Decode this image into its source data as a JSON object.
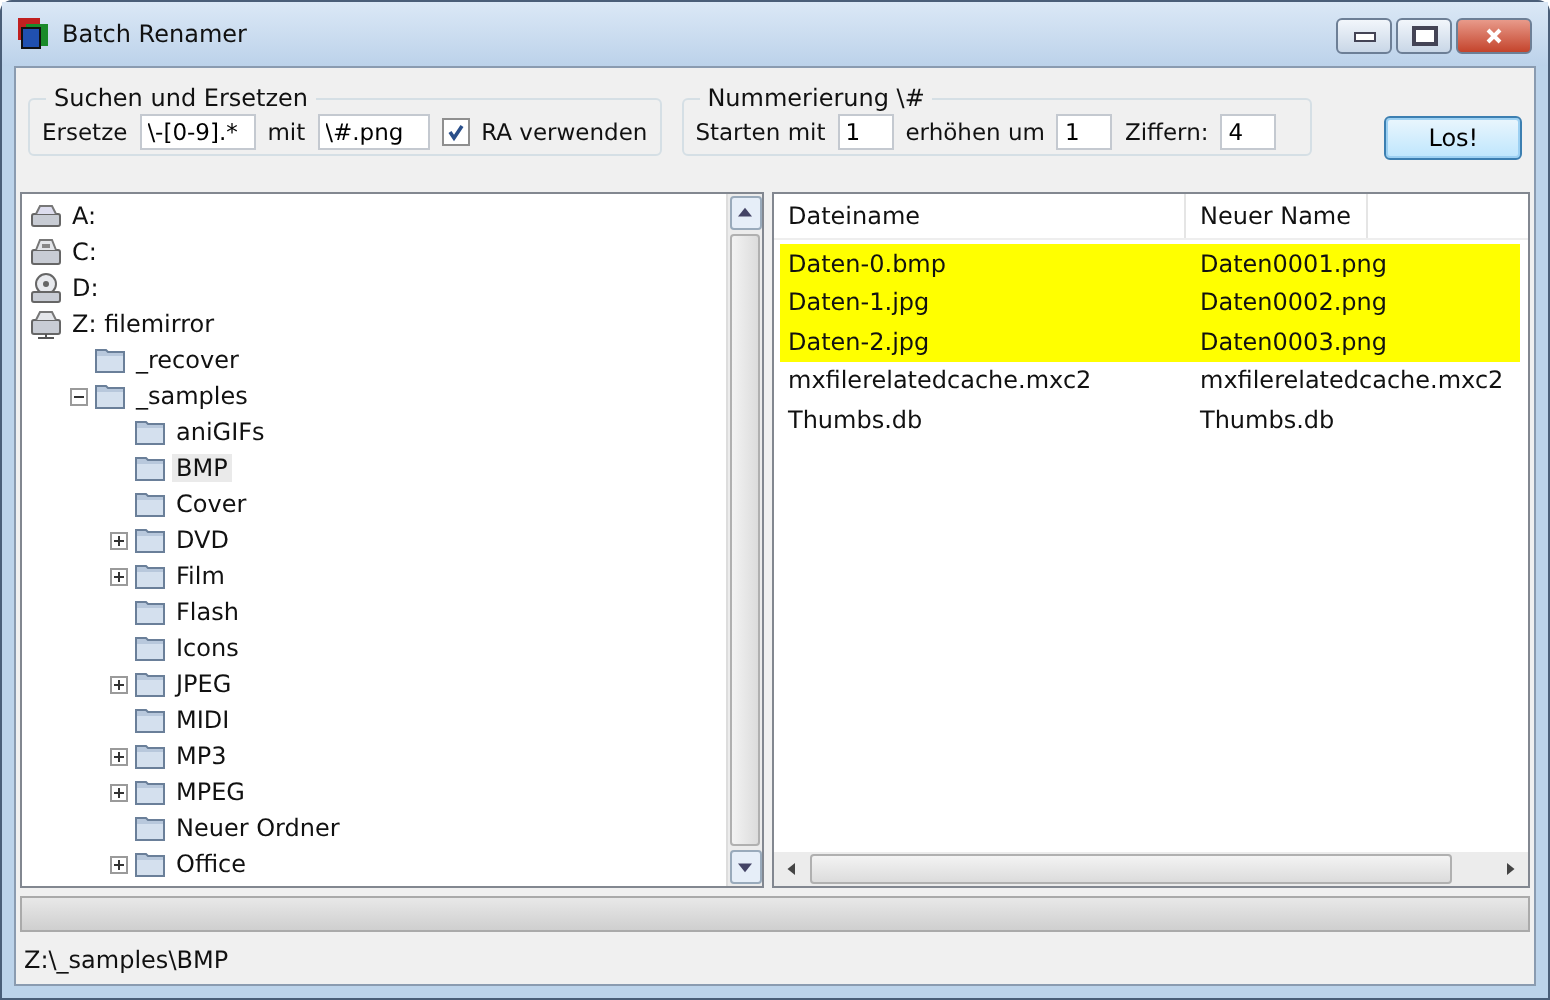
{
  "window": {
    "title": "Batch Renamer"
  },
  "search_replace": {
    "title": "Suchen und Ersetzen",
    "replace_label": "Ersetze",
    "replace_value": "\\-[0-9].*",
    "with_label": "mit",
    "with_value": "\\#.png",
    "regex_label": "RA verwenden",
    "regex_checked": true
  },
  "numbering": {
    "title": "Nummerierung \\#",
    "start_label": "Starten mit",
    "start_value": "1",
    "step_label": "erhöhen um",
    "step_value": "1",
    "digits_label": "Ziffern:",
    "digits_value": "4"
  },
  "go_button": "Los!",
  "tree": [
    {
      "label": "A:",
      "kind": "floppy",
      "selected": false
    },
    {
      "label": "C:",
      "kind": "drive",
      "selected": false
    },
    {
      "label": "D:",
      "kind": "cdrom",
      "selected": false
    },
    {
      "label": "Z: filemirror",
      "kind": "network",
      "selected": false,
      "children": [
        {
          "label": "_recover",
          "kind": "folder",
          "selected": false
        },
        {
          "label": "_samples",
          "kind": "folder",
          "selected": false,
          "expanded": true,
          "children": [
            {
              "label": "aniGIFs",
              "kind": "folder",
              "selected": false
            },
            {
              "label": "BMP",
              "kind": "folder",
              "selected": true
            },
            {
              "label": "Cover",
              "kind": "folder",
              "selected": false
            },
            {
              "label": "DVD",
              "kind": "folder",
              "selected": false,
              "expanded": false
            },
            {
              "label": "Film",
              "kind": "folder",
              "selected": false,
              "expanded": false
            },
            {
              "label": "Flash",
              "kind": "folder",
              "selected": false
            },
            {
              "label": "Icons",
              "kind": "folder",
              "selected": false
            },
            {
              "label": "JPEG",
              "kind": "folder",
              "selected": false,
              "expanded": false
            },
            {
              "label": "MIDI",
              "kind": "folder",
              "selected": false
            },
            {
              "label": "MP3",
              "kind": "folder",
              "selected": false,
              "expanded": false
            },
            {
              "label": "MPEG",
              "kind": "folder",
              "selected": false,
              "expanded": false
            },
            {
              "label": "Neuer Ordner",
              "kind": "folder",
              "selected": false
            },
            {
              "label": "Office",
              "kind": "folder",
              "selected": false,
              "expanded": false
            }
          ]
        }
      ]
    }
  ],
  "file_list": {
    "columns": [
      "Dateiname",
      "Neuer Name"
    ],
    "rows": [
      {
        "cells": [
          "Daten-0.bmp",
          "Daten0001.png"
        ],
        "highlighted": true
      },
      {
        "cells": [
          "Daten-1.jpg",
          "Daten0002.png"
        ],
        "highlighted": true
      },
      {
        "cells": [
          "Daten-2.jpg",
          "Daten0003.png"
        ],
        "highlighted": true
      },
      {
        "cells": [
          "mxfilerelatedcache.mxc2",
          "mxfilerelatedcache.mxc2"
        ],
        "highlighted": false
      },
      {
        "cells": [
          "Thumbs.db",
          "Thumbs.db"
        ],
        "highlighted": false
      }
    ]
  },
  "status_bar": {
    "path": "Z:\\_samples\\BMP"
  }
}
